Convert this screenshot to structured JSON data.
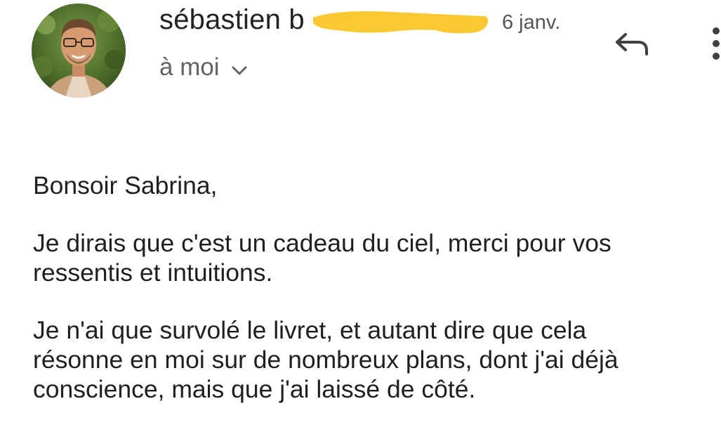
{
  "header": {
    "sender_name": "sébastien b",
    "date": "6 janv.",
    "recipient": "à moi",
    "icons": {
      "avatar": "sender-avatar-photo",
      "recipient_toggle": "chevron-down-icon",
      "reply": "reply-icon",
      "more": "more-vert-icon"
    },
    "colors": {
      "redaction": "#f9c832"
    }
  },
  "body": {
    "greeting": "Bonsoir Sabrina,",
    "para1": {
      "line1": "Je dirais que c'est un cadeau du ciel, merci pour vos",
      "line2": "ressentis et intuitions."
    },
    "para2": {
      "line1": "Je n'ai que survolé le livret, et autant dire que cela",
      "line2": "résonne en moi sur de nombreux plans, dont j'ai déjà",
      "line3": "conscience, mais que j'ai laissé de côté."
    }
  }
}
